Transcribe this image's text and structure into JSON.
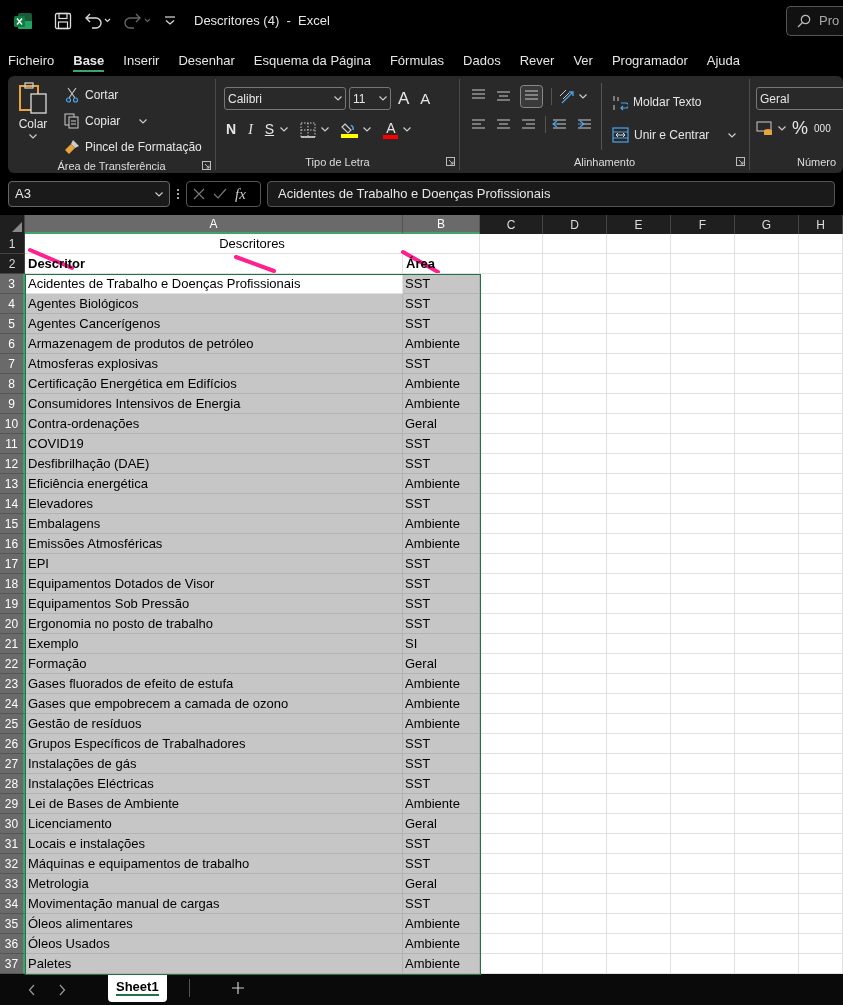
{
  "window": {
    "title": "Descritores (4)  -  Excel",
    "search_placeholder": "Pro"
  },
  "menu_tabs": [
    {
      "label": "Ficheiro",
      "selected": false
    },
    {
      "label": "Base",
      "selected": true
    },
    {
      "label": "Inserir",
      "selected": false
    },
    {
      "label": "Desenhar",
      "selected": false
    },
    {
      "label": "Esquema da Página",
      "selected": false
    },
    {
      "label": "Fórmulas",
      "selected": false
    },
    {
      "label": "Dados",
      "selected": false
    },
    {
      "label": "Rever",
      "selected": false
    },
    {
      "label": "Ver",
      "selected": false
    },
    {
      "label": "Programador",
      "selected": false
    },
    {
      "label": "Ajuda",
      "selected": false
    }
  ],
  "ribbon": {
    "clipboard": {
      "paste": "Colar",
      "cut": "Cortar",
      "copy": "Copiar",
      "format_painter": "Pincel de Formatação",
      "group": "Área de Transferência"
    },
    "font": {
      "name": "Calibri",
      "size": "11",
      "grow": "A",
      "shrink": "A",
      "bold": "N",
      "italic": "I",
      "underline": "S",
      "font_color": "A",
      "group": "Tipo de Letra"
    },
    "alignment": {
      "wrap": "Moldar Texto",
      "merge": "Unir e Centrar",
      "group": "Alinhamento"
    },
    "number": {
      "format": "Geral",
      "percent": "%",
      "thousands": "000",
      "group": "Número"
    }
  },
  "formula_bar": {
    "name_box": "A3",
    "function_label": "fx",
    "formula": "Acidentes de Trabalho e Doenças Profissionais"
  },
  "columns": [
    {
      "label": "A",
      "selected": true
    },
    {
      "label": "B",
      "selected": true
    },
    {
      "label": "C",
      "selected": false
    },
    {
      "label": "D",
      "selected": false
    },
    {
      "label": "E",
      "selected": false
    },
    {
      "label": "F",
      "selected": false
    },
    {
      "label": "G",
      "selected": false
    },
    {
      "label": "H",
      "selected": false
    }
  ],
  "title_row": {
    "number": "1",
    "text": "Descritores"
  },
  "header_row": {
    "number": "2",
    "descritor": "Descritor",
    "area": "Área"
  },
  "rows": [
    {
      "number": "3",
      "descritor": "Acidentes de Trabalho e Doenças Profissionais",
      "area": "SST",
      "active": true
    },
    {
      "number": "4",
      "descritor": "Agentes Biológicos",
      "area": "SST",
      "active": false
    },
    {
      "number": "5",
      "descritor": "Agentes Cancerígenos",
      "area": "SST",
      "active": false
    },
    {
      "number": "6",
      "descritor": "Armazenagem de produtos de petróleo",
      "area": "Ambiente",
      "active": false
    },
    {
      "number": "7",
      "descritor": "Atmosferas explosivas",
      "area": "SST",
      "active": false
    },
    {
      "number": "8",
      "descritor": "Certificação Energética em Edifícios",
      "area": "Ambiente",
      "active": false
    },
    {
      "number": "9",
      "descritor": "Consumidores Intensivos de Energia",
      "area": "Ambiente",
      "active": false
    },
    {
      "number": "10",
      "descritor": "Contra-ordenações",
      "area": "Geral",
      "active": false
    },
    {
      "number": "11",
      "descritor": "COVID19",
      "area": "SST",
      "active": false
    },
    {
      "number": "12",
      "descritor": "Desfibrilhação (DAE)",
      "area": "SST",
      "active": false
    },
    {
      "number": "13",
      "descritor": "Eficiência energética",
      "area": "Ambiente",
      "active": false
    },
    {
      "number": "14",
      "descritor": "Elevadores",
      "area": "SST",
      "active": false
    },
    {
      "number": "15",
      "descritor": "Embalagens",
      "area": "Ambiente",
      "active": false
    },
    {
      "number": "16",
      "descritor": "Emissões Atmosféricas",
      "area": "Ambiente",
      "active": false
    },
    {
      "number": "17",
      "descritor": "EPI",
      "area": "SST",
      "active": false
    },
    {
      "number": "18",
      "descritor": "Equipamentos Dotados de Visor",
      "area": "SST",
      "active": false
    },
    {
      "number": "19",
      "descritor": "Equipamentos Sob Pressão",
      "area": "SST",
      "active": false
    },
    {
      "number": "20",
      "descritor": "Ergonomia no posto de trabalho",
      "area": "SST",
      "active": false
    },
    {
      "number": "21",
      "descritor": "Exemplo",
      "area": "SI",
      "active": false
    },
    {
      "number": "22",
      "descritor": "Formação",
      "area": "Geral",
      "active": false
    },
    {
      "number": "23",
      "descritor": "Gases fluorados de efeito de estufa",
      "area": "Ambiente",
      "active": false
    },
    {
      "number": "24",
      "descritor": "Gases que empobrecem a camada de ozono",
      "area": "Ambiente",
      "active": false
    },
    {
      "number": "25",
      "descritor": "Gestão de resíduos",
      "area": "Ambiente",
      "active": false
    },
    {
      "number": "26",
      "descritor": "Grupos Específicos de Trabalhadores",
      "area": "SST",
      "active": false
    },
    {
      "number": "27",
      "descritor": "Instalações de gás",
      "area": "SST",
      "active": false
    },
    {
      "number": "28",
      "descritor": "Instalações Eléctricas",
      "area": "SST",
      "active": false
    },
    {
      "number": "29",
      "descritor": "Lei de Bases de Ambiente",
      "area": "Ambiente",
      "active": false
    },
    {
      "number": "30",
      "descritor": "Licenciamento",
      "area": "Geral",
      "active": false
    },
    {
      "number": "31",
      "descritor": "Locais e instalações",
      "area": "SST",
      "active": false
    },
    {
      "number": "32",
      "descritor": "Máquinas e equipamentos de trabalho",
      "area": "SST",
      "active": false
    },
    {
      "number": "33",
      "descritor": "Metrologia",
      "area": "Geral",
      "active": false
    },
    {
      "number": "34",
      "descritor": "Movimentação manual de cargas",
      "area": "SST",
      "active": false
    },
    {
      "number": "35",
      "descritor": "Óleos alimentares",
      "area": "Ambiente",
      "active": false
    },
    {
      "number": "36",
      "descritor": "Óleos Usados",
      "area": "Ambiente",
      "active": false
    },
    {
      "number": "37",
      "descritor": "Paletes",
      "area": "Ambiente",
      "active": false
    }
  ],
  "sheet_tabs": [
    {
      "label": "Sheet1",
      "selected": true
    }
  ],
  "annotation_strokes": [
    {
      "kind": "stroke"
    },
    {
      "kind": "stroke"
    },
    {
      "kind": "stroke"
    }
  ]
}
